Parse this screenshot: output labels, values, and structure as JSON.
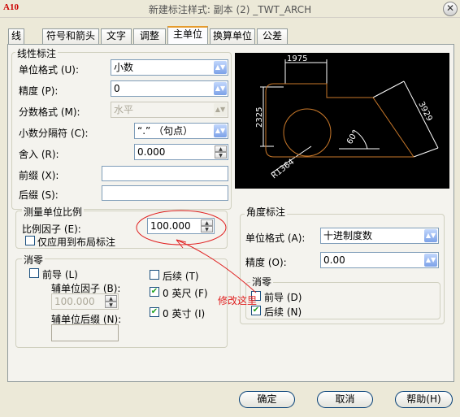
{
  "window": {
    "title": "新建标注样式: 副本 (2) _TWT_ARCH",
    "app_icon_text": "A10"
  },
  "tabs": [
    "线",
    "符号和箭头",
    "文字",
    "调整",
    "主单位",
    "换算单位",
    "公差"
  ],
  "active_tab": "主单位",
  "linear": {
    "group_title": "线性标注",
    "unit_format_label": "单位格式 (U):",
    "unit_format_value": "小数",
    "precision_label": "精度 (P):",
    "precision_value": "0",
    "fraction_format_label": "分数格式 (M):",
    "fraction_format_value": "水平",
    "decimal_sep_label": "小数分隔符 (C):",
    "decimal_sep_value": "“.” （句点）",
    "round_label": "舍入 (R):",
    "round_value": "0.000",
    "prefix_label": "前缀 (X):",
    "suffix_label": "后缀 (S):"
  },
  "scale": {
    "group_title": "测量单位比例",
    "factor_label": "比例因子 (E):",
    "factor_value": "100.000",
    "layout_only_label": "仅应用到布局标注"
  },
  "zero_linear": {
    "group_title": "消零",
    "leading_label": "前导 (L)",
    "trailing_label": "后续 (T)",
    "sub_factor_label": "辅单位因子 (B):",
    "sub_factor_value": "100.000",
    "sub_suffix_label": "辅单位后缀 (N):",
    "feet_label": "0 英尺 (F)",
    "inches_label": "0 英寸 (I)"
  },
  "angular": {
    "group_title": "角度标注",
    "unit_format_label": "单位格式 (A):",
    "unit_format_value": "十进制度数",
    "precision_label": "精度 (O):",
    "precision_value": "0.00"
  },
  "zero_angular": {
    "group_title": "消零",
    "leading_label": "前导 (D)",
    "trailing_label": "后续 (N)"
  },
  "preview": {
    "dim_top": "1975",
    "dim_left": "2325",
    "dim_right": "3929",
    "dim_radius": "R1364",
    "dim_angle": "60°"
  },
  "annotation": {
    "text": "修改这里"
  },
  "buttons": {
    "ok": "确定",
    "cancel": "取消",
    "help": "帮助(H)"
  },
  "colors": {
    "accent": "#e69b2c",
    "annotation_red": "#e02020",
    "preview_bg": "#000000",
    "shape": "#c8782a"
  }
}
